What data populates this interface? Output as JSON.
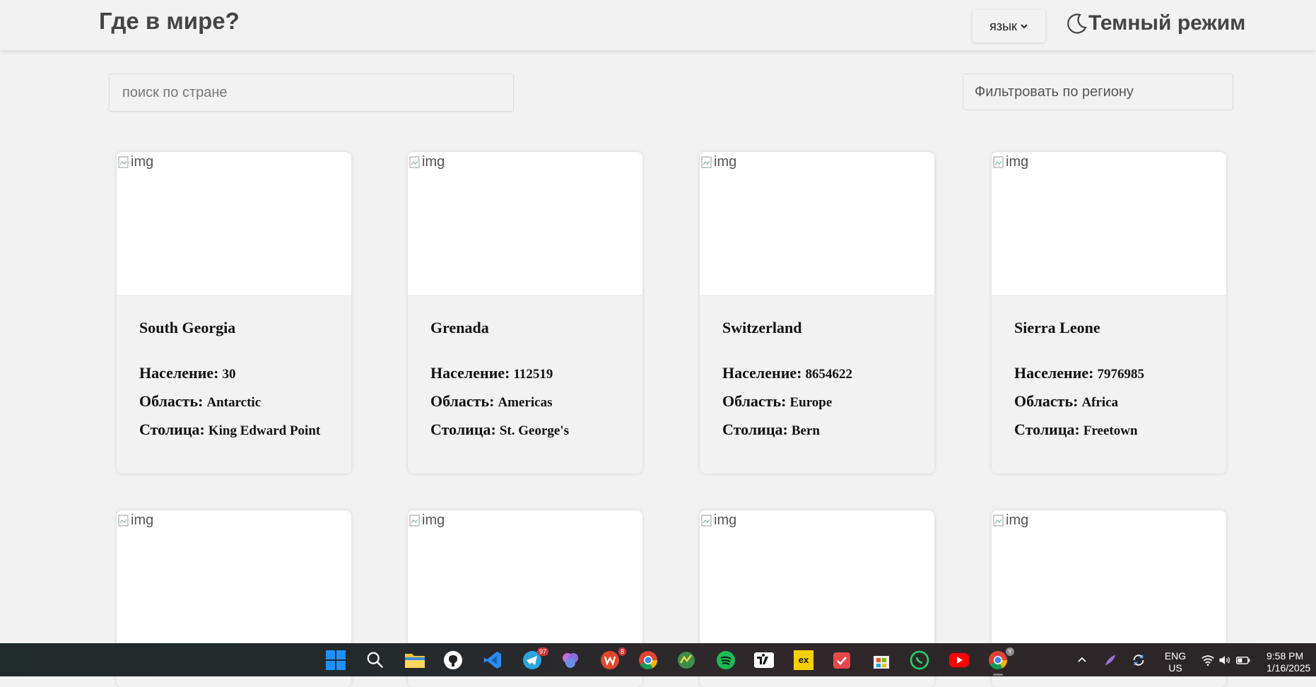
{
  "header": {
    "title": "Где в мире?",
    "language_label": "язык",
    "dark_mode_label": "Темный режим"
  },
  "search": {
    "placeholder": "поиск по стране"
  },
  "filter": {
    "label": "Фильтровать по региону"
  },
  "labels": {
    "population": "Население:",
    "region": "Область:",
    "capital": "Столица:",
    "img_alt": "img"
  },
  "countries": [
    {
      "name": "South Georgia",
      "population": "30",
      "region": "Antarctic",
      "capital": "King Edward Point"
    },
    {
      "name": "Grenada",
      "population": "112519",
      "region": "Americas",
      "capital": "St. George's"
    },
    {
      "name": "Switzerland",
      "population": "8654622",
      "region": "Europe",
      "capital": "Bern"
    },
    {
      "name": "Sierra Leone",
      "population": "7976985",
      "region": "Africa",
      "capital": "Freetown"
    }
  ],
  "taskbar": {
    "telegram_badge": "97",
    "wps_badge": "8",
    "chrome_badge": "Y",
    "lang_primary": "ENG",
    "lang_secondary": "US",
    "time": "9:58 PM",
    "date": "1/16/2025"
  },
  "colors": {
    "background": "#f2f2f2",
    "card": "#ffffff",
    "taskbar": "#252a2c"
  }
}
